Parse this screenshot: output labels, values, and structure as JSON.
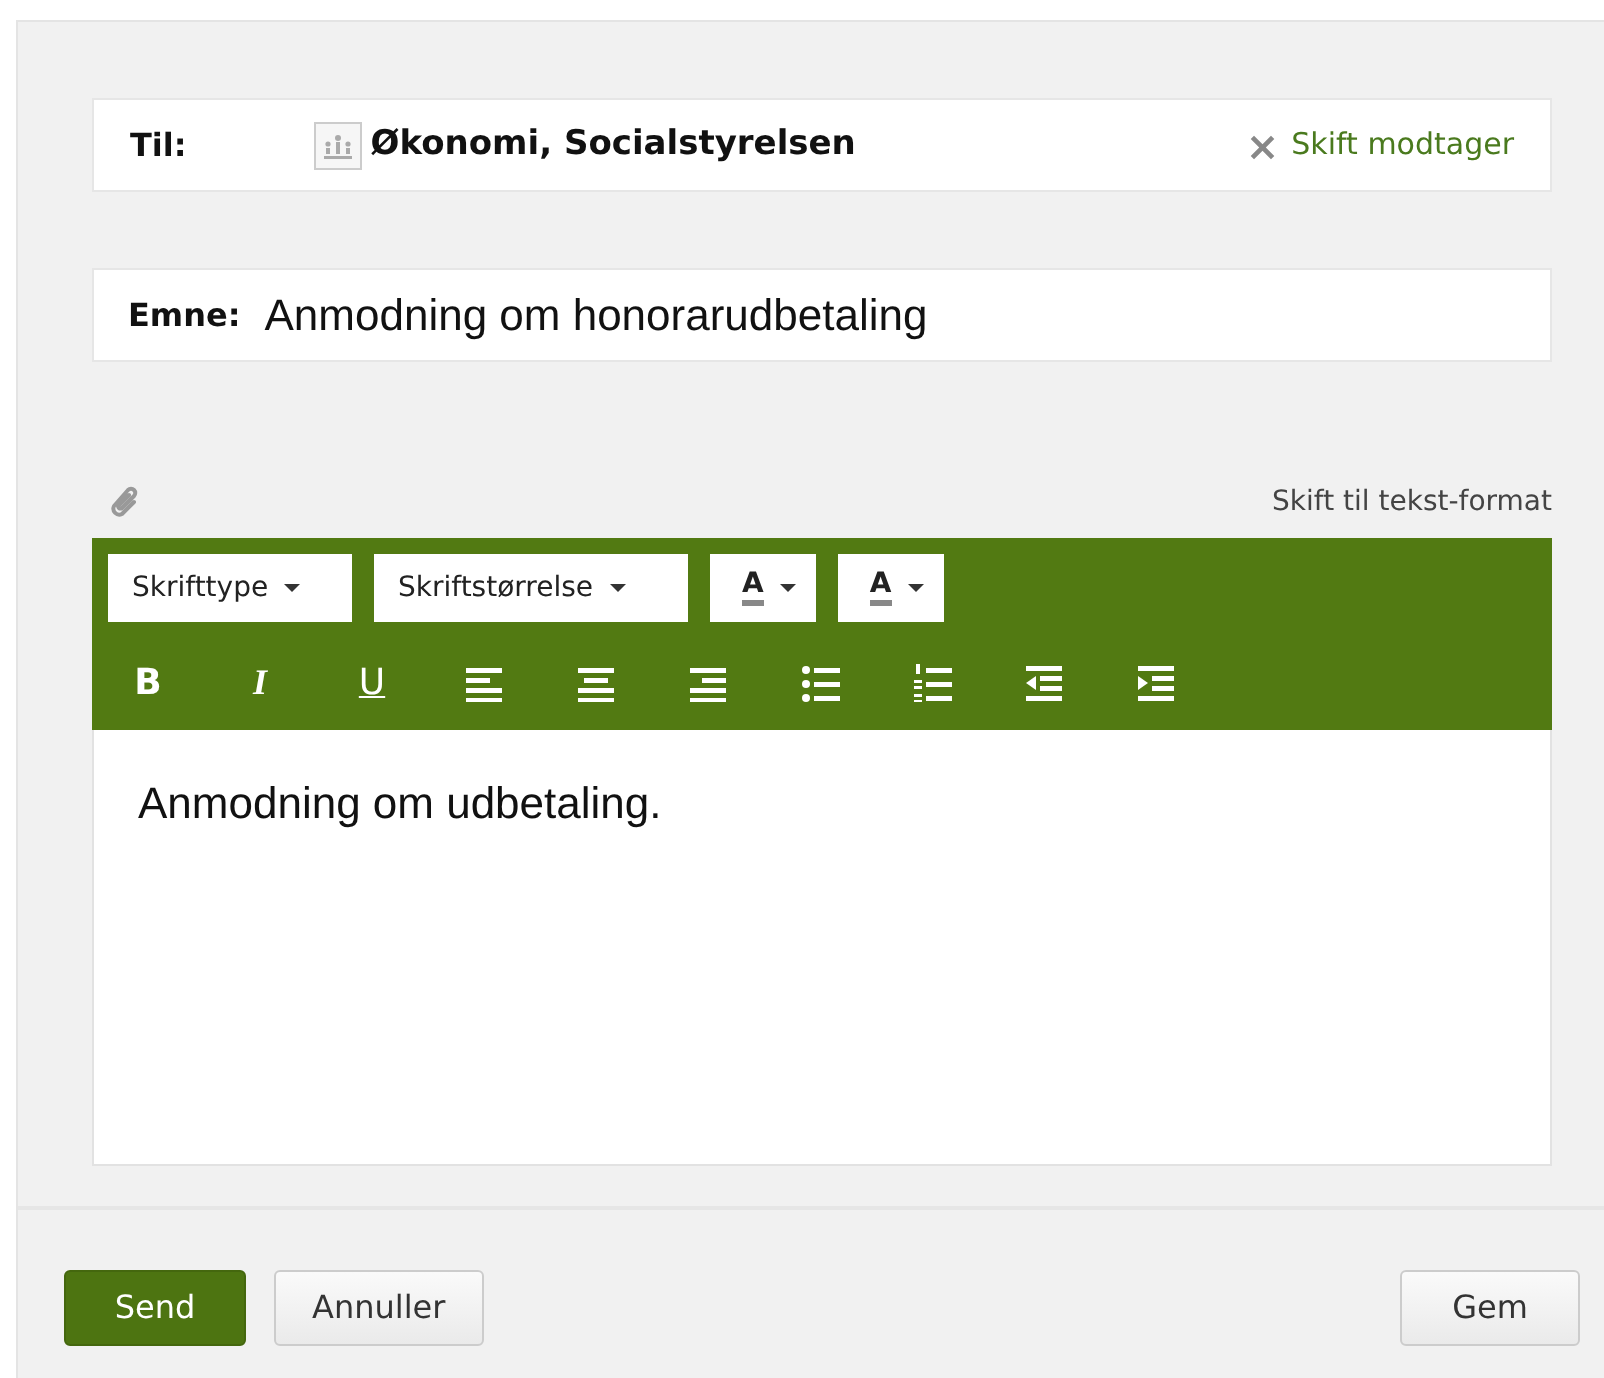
{
  "recipient": {
    "label": "Til:",
    "name": "Økonomi, Socialstyrelsen",
    "change_link": "Skift modtager",
    "remove_glyph": "×"
  },
  "subject": {
    "label": "Emne:",
    "value": "Anmodning om honorarudbetaling"
  },
  "format_link": "Skift til tekst-format",
  "toolbar": {
    "dropdowns": [
      {
        "kind": "select",
        "label": "Skrifttype"
      },
      {
        "kind": "select",
        "label": "Skriftstørrelse"
      },
      {
        "kind": "color",
        "label": "A"
      },
      {
        "kind": "color",
        "label": "A"
      }
    ],
    "style_buttons": [
      "B",
      "I",
      "U"
    ]
  },
  "body": "Anmodning om udbetaling.",
  "buttons": [
    {
      "kind": "primary",
      "label": "Send"
    },
    {
      "kind": "secondary",
      "label": "Annuller"
    },
    {
      "kind": "right",
      "label": "Gem"
    }
  ]
}
